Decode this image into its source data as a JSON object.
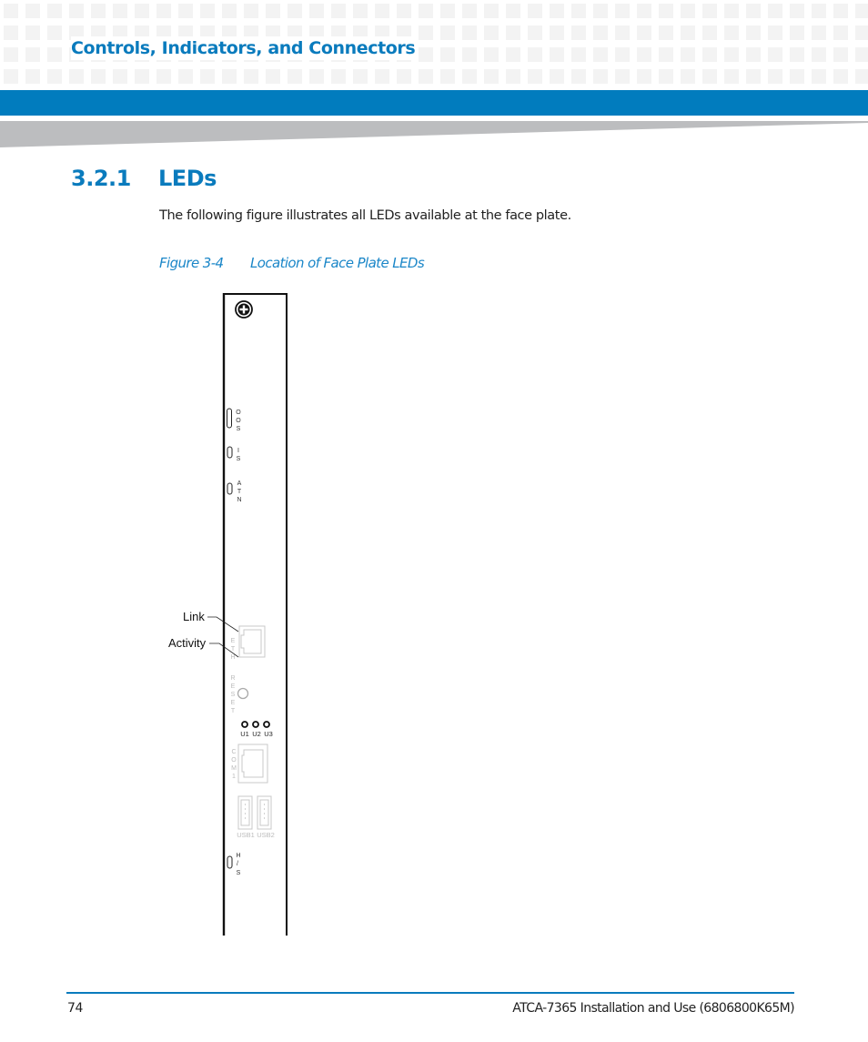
{
  "header": {
    "running_head": "Controls, Indicators, and Connectors",
    "accent_color": "#017cbe"
  },
  "section": {
    "number": "3.2.1",
    "title": "LEDs",
    "intro": "The following figure illustrates all LEDs available at the face plate."
  },
  "figure": {
    "number": "Figure 3-4",
    "caption": "Location of Face Plate LEDs",
    "callouts": {
      "link": "Link",
      "activity": "Activity"
    },
    "faceplate_labels": {
      "oos": [
        "O",
        "O",
        "S"
      ],
      "is": [
        "I",
        "S"
      ],
      "atn": [
        "A",
        "T",
        "N"
      ],
      "eth": [
        "E",
        "T",
        "H"
      ],
      "reset": [
        "R",
        "E",
        "S",
        "E",
        "T"
      ],
      "user_leds": [
        "U1",
        "U2",
        "U3"
      ],
      "com": [
        "C",
        "O",
        "M",
        "1"
      ],
      "usb1": "USB1",
      "usb2": "USB2",
      "hs": [
        "H",
        "/",
        "S"
      ]
    }
  },
  "footer": {
    "page_number": "74",
    "doc_title": "ATCA-7365 Installation and Use (6806800K65M)"
  }
}
